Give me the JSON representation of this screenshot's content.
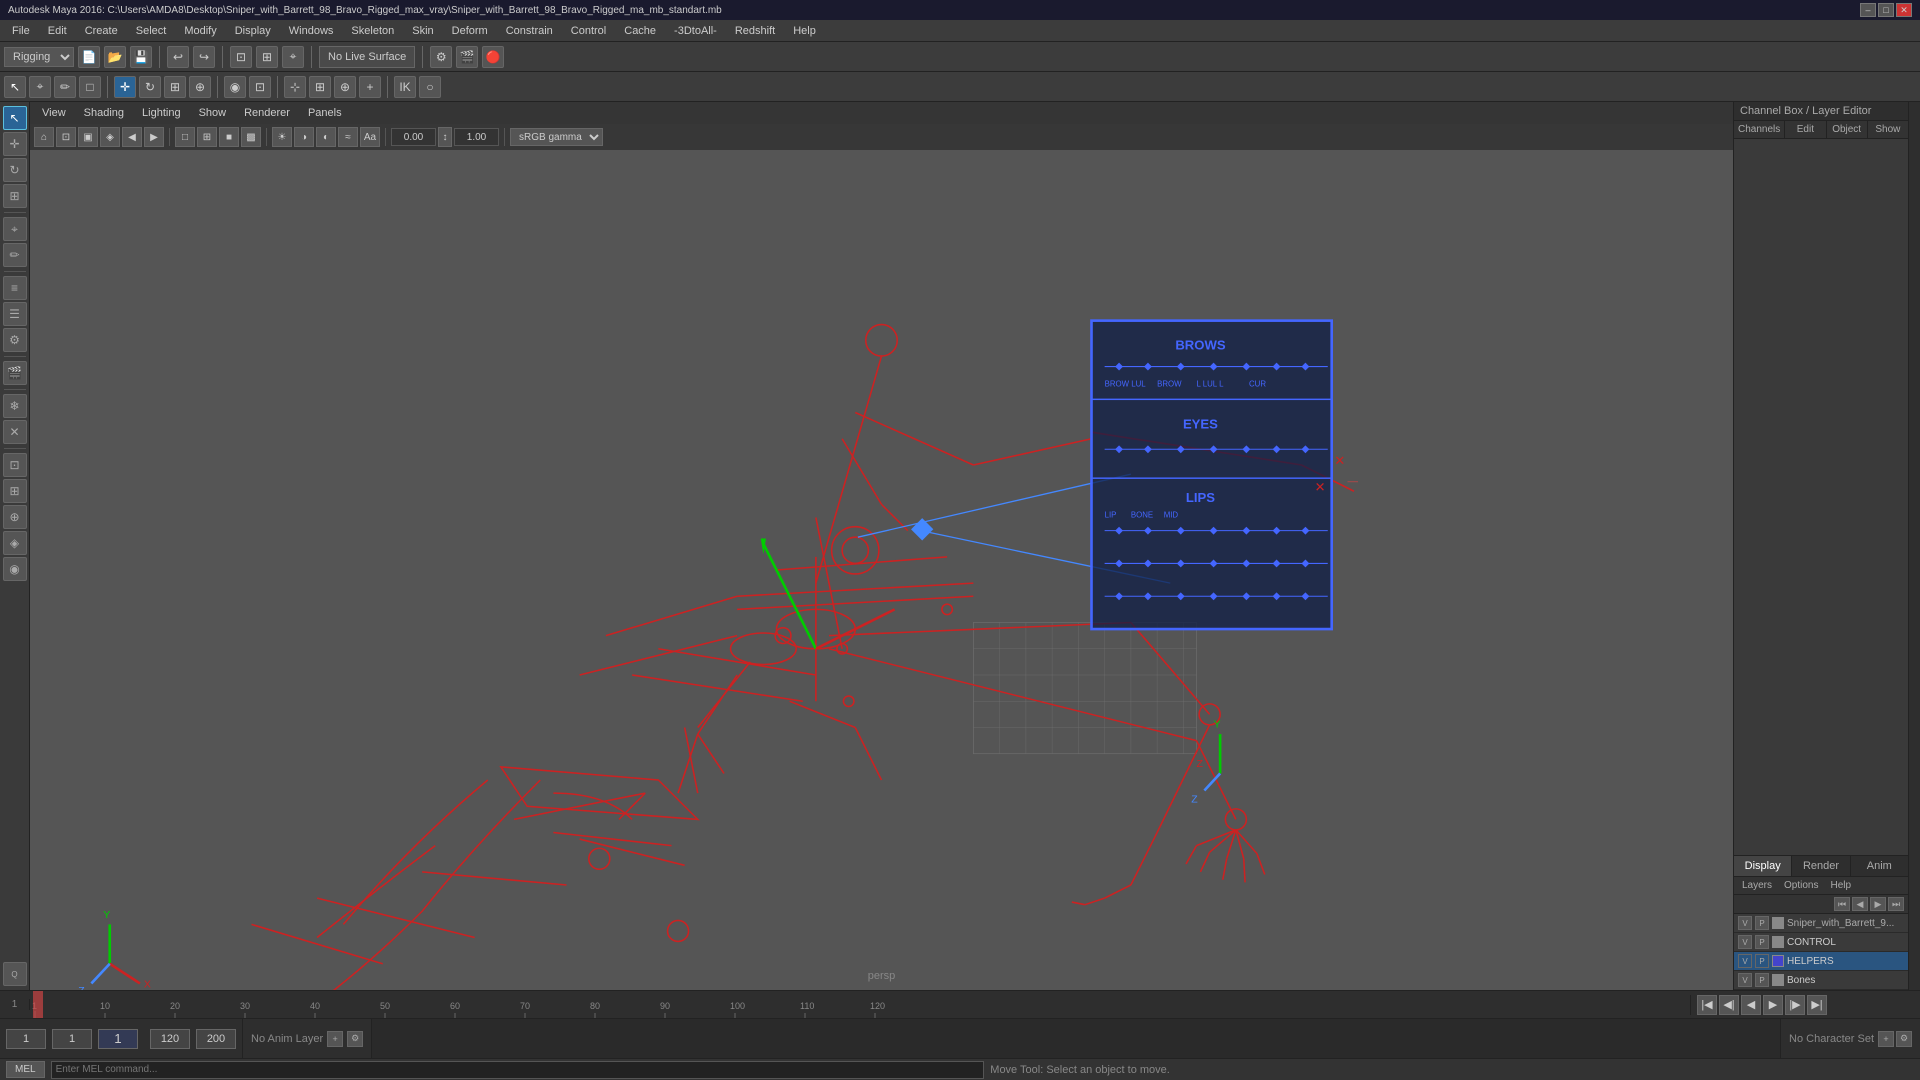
{
  "titlebar": {
    "title": "Autodesk Maya 2016: C:\\Users\\AMDA8\\Desktop\\Sniper_with_Barrett_98_Bravo_Rigged_max_vray\\Sniper_with_Barrett_98_Bravo_Rigged_ma_mb_standart.mb",
    "min": "–",
    "max": "□",
    "close": "✕"
  },
  "menubar": {
    "items": [
      "File",
      "Edit",
      "Create",
      "Select",
      "Modify",
      "Display",
      "Windows",
      "Skeleton",
      "Skin",
      "Deform",
      "Constrain",
      "Control",
      "Cache",
      "-3DtoAll-",
      "Redshift",
      "Help"
    ]
  },
  "toolbar1": {
    "mode": "Rigging",
    "no_live_surface": "No Live Surface"
  },
  "viewport": {
    "menu_items": [
      "View",
      "Shading",
      "Lighting",
      "Show",
      "Renderer",
      "Panels"
    ],
    "persp_label": "persp",
    "gamma_label": "sRGB gamma",
    "val1": "0.00",
    "val2": "1.00"
  },
  "right_panel": {
    "header": "Channel Box / Layer Editor",
    "tabs": [
      "Channels",
      "Edit",
      "Object",
      "Show"
    ],
    "dra_tabs": [
      "Display",
      "Render",
      "Anim"
    ],
    "layer_tabs": [
      "Layers",
      "Options",
      "Help"
    ],
    "layers": [
      {
        "name": "Sniper_with_Barrett_98...",
        "color": "#888888",
        "vp_label": "V",
        "p_label": "P"
      },
      {
        "name": "CONTROL",
        "color": "#888888",
        "vp_label": "V",
        "p_label": "P"
      },
      {
        "name": "HELPERS",
        "color": "#4444cc",
        "vp_label": "V",
        "p_label": "P",
        "selected": true
      },
      {
        "name": "Bones",
        "color": "#888888",
        "vp_label": "V",
        "p_label": "P"
      }
    ]
  },
  "timeline": {
    "markers": [
      "1",
      "10",
      "20",
      "30",
      "40",
      "50",
      "60",
      "70",
      "80",
      "90",
      "100",
      "110",
      "120"
    ]
  },
  "playback": {
    "current_frame": "1",
    "start_frame": "1",
    "end_frame": "120",
    "range_start": "1",
    "range_end": "200",
    "anim_layer": "No Anim Layer",
    "char_set": "No Character Set"
  },
  "bottom_bar": {
    "mel_label": "MEL",
    "status_text": "Move Tool: Select an object to move.",
    "frame_box_val": "1",
    "frame_box2_val": "1",
    "frame_box3_val": "1"
  },
  "face_controls": {
    "brows_label": "BROWS",
    "eyes_label": "EYES",
    "lips_label": "LIPS"
  },
  "icons": {
    "select": "↖",
    "move": "✛",
    "rotate": "↻",
    "scale": "⊞",
    "lasso": "⌖",
    "paint": "✏",
    "snap": "⊕",
    "minimize": "–",
    "maximize": "□",
    "close": "✕",
    "play_back": "⏮",
    "play_prev": "⏪",
    "play_step_back": "◀",
    "play_play": "▶",
    "play_step_fwd": "▶▶",
    "play_fwd": "⏩",
    "play_end": "⏭",
    "nav_left": "◀",
    "nav_right": "▶",
    "nav_up": "▲",
    "nav_down": "▼"
  }
}
